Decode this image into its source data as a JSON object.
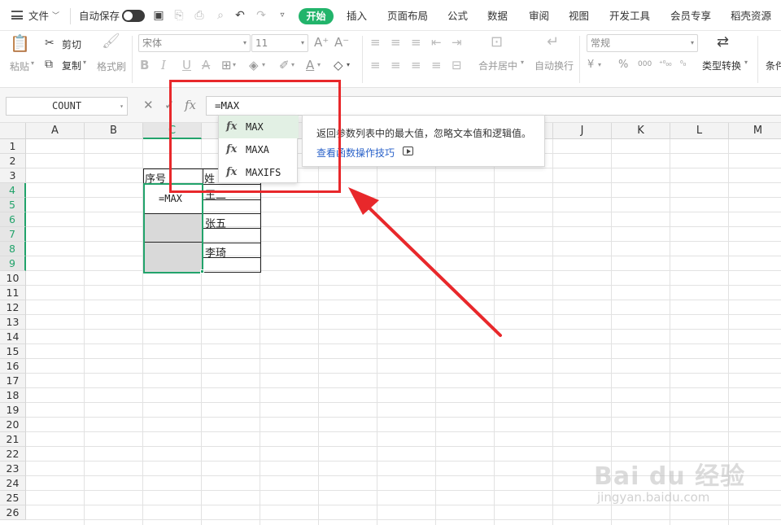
{
  "menubar": {
    "file": "文件",
    "autosave": "自动保存",
    "tabs": [
      "开始",
      "插入",
      "页面布局",
      "公式",
      "数据",
      "审阅",
      "视图",
      "开发工具",
      "会员专享",
      "稻壳资源"
    ]
  },
  "ribbon": {
    "paste": "粘贴",
    "cut": "剪切",
    "copy": "复制",
    "format_painter": "格式刷",
    "font_name": "宋体",
    "font_size": "11",
    "merge_center": "合并居中",
    "wrap_text": "自动换行",
    "number_format": "常规",
    "type_convert": "类型转换",
    "conditional": "条件"
  },
  "formula_bar": {
    "name_box": "COUNT",
    "fx": "fx",
    "formula": "=MAX"
  },
  "grid": {
    "columns": [
      "A",
      "B",
      "C",
      "D",
      "E",
      "F",
      "G",
      "H",
      "I",
      "J",
      "K",
      "L",
      "M"
    ],
    "rows": [
      "1",
      "2",
      "3",
      "4",
      "5",
      "6",
      "7",
      "8",
      "9",
      "10",
      "11",
      "12",
      "13",
      "14",
      "15",
      "16",
      "17",
      "18",
      "19",
      "20",
      "21",
      "22",
      "23",
      "24",
      "25",
      "26"
    ],
    "selected_column": "C",
    "selected_rows": [
      "4",
      "5",
      "6",
      "7",
      "8",
      "9"
    ]
  },
  "cells": {
    "c3_header": "序号",
    "d3_header": "姓",
    "c4_editing": "=MAX",
    "d4_value": "王二",
    "d6_value": "张五",
    "d8_value": "李琦"
  },
  "autocomplete": {
    "items": [
      {
        "fx": "fx",
        "name": "MAX"
      },
      {
        "fx": "fx",
        "name": "MAXA"
      },
      {
        "fx": "fx",
        "name": "MAXIFS"
      }
    ],
    "description": "返回参数列表中的最大值，忽略文本值和逻辑值。",
    "link": "查看函数操作技巧"
  },
  "watermark": {
    "brand": "Bai du 经验",
    "url": "jingyan.baidu.com"
  },
  "colors": {
    "accent": "#22b46b",
    "selection": "#22a36b",
    "annotation": "#e8282b",
    "link": "#2a62c9"
  }
}
